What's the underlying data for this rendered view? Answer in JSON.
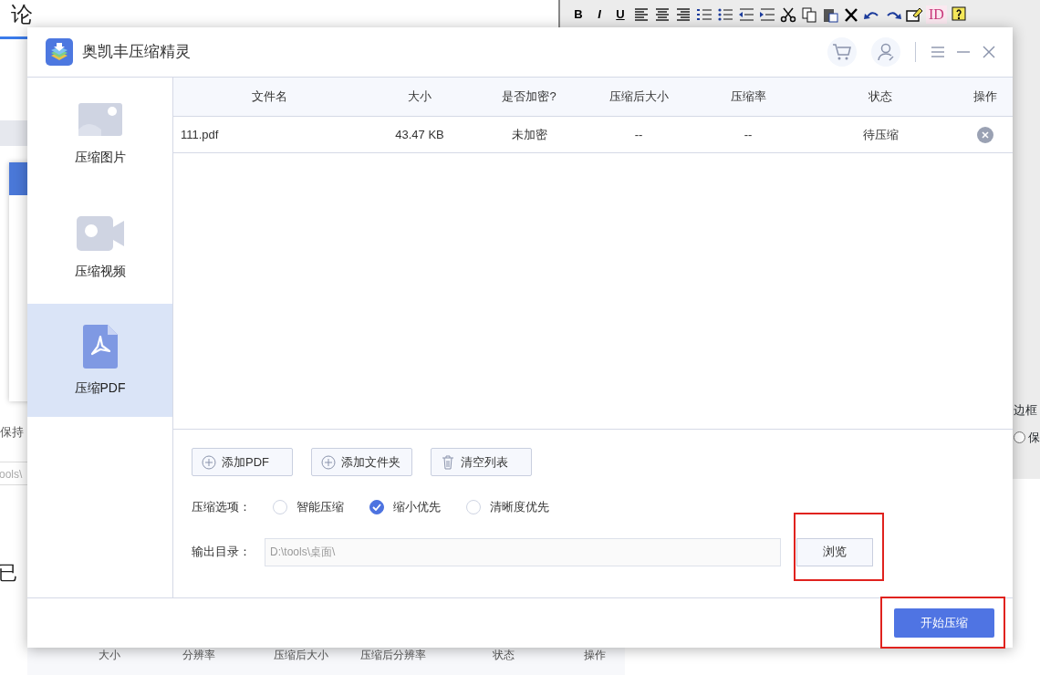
{
  "background_left": {
    "heading": "论",
    "option_text": "保持",
    "path_text": "ools\\",
    "notice": "已",
    "table_columns": [
      "大小",
      "分辨率",
      "压缩后大小",
      "压缩后分辨率",
      "状态",
      "操作"
    ]
  },
  "background_right": {
    "format_buttons": [
      "B",
      "I",
      "U"
    ],
    "id_button": "ID",
    "label": "边框",
    "radio": {
      "label": "保",
      "checked": false
    }
  },
  "app": {
    "title": "奥凯丰压缩精灵"
  },
  "sidebar": [
    {
      "label": "压缩图片",
      "kind": "image",
      "selected": false
    },
    {
      "label": "压缩视频",
      "kind": "video",
      "selected": false
    },
    {
      "label": "压缩PDF",
      "kind": "pdf",
      "selected": true
    }
  ],
  "table": {
    "columns": [
      "文件名",
      "大小",
      "是否加密?",
      "压缩后大小",
      "压缩率",
      "状态",
      "操作"
    ],
    "rows": [
      {
        "name": "111.pdf",
        "size": "43.47 KB",
        "encrypted": "未加密",
        "compressed_size": "--",
        "ratio": "--",
        "status": "待压缩"
      }
    ]
  },
  "actions": [
    {
      "kind": "add",
      "label": "添加PDF"
    },
    {
      "kind": "add",
      "label": "添加文件夹"
    },
    {
      "kind": "clear",
      "label": "清空列表"
    }
  ],
  "options": {
    "label": "压缩选项：",
    "choices": [
      {
        "label": "智能压缩",
        "selected": false
      },
      {
        "label": "缩小优先",
        "selected": true
      },
      {
        "label": "清晰度优先",
        "selected": false
      }
    ]
  },
  "output": {
    "label": "输出目录：",
    "value": "D:\\tools\\桌面\\",
    "browse": {
      "label": "浏览",
      "highlighted": true
    }
  },
  "start": {
    "label": "开始压缩",
    "highlighted": true
  }
}
